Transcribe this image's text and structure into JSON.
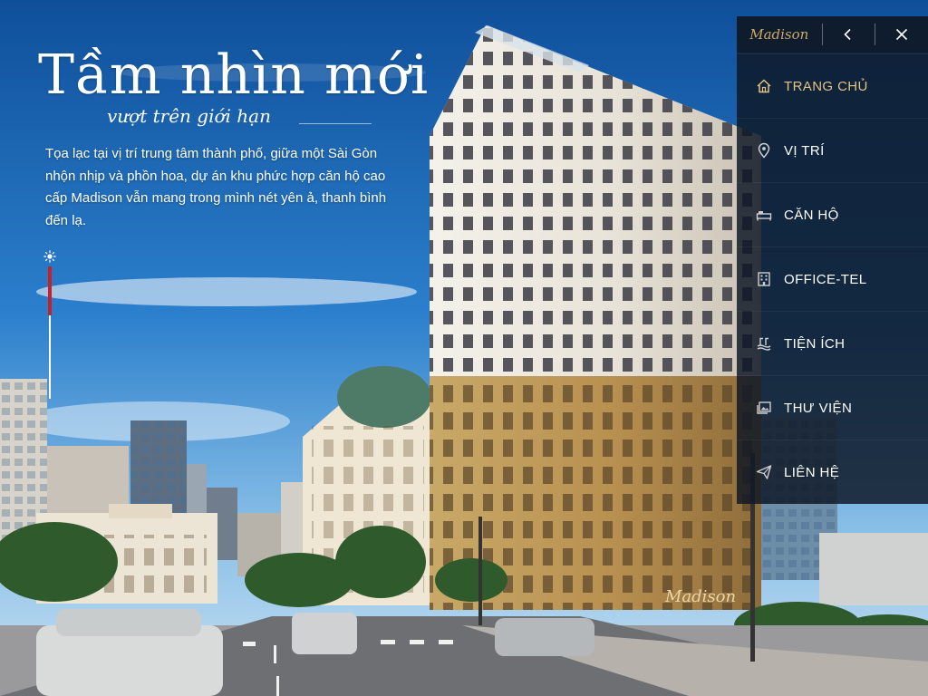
{
  "hero": {
    "title": "Tầm nhìn mới",
    "subtitle": "vượt trên giới hạn",
    "description": "Tọa lạc tại vị trí trung tâm thành phố, giữa một Sài Gòn nhộn nhịp và phồn hoa, dự án khu phức hợp căn hộ cao cấp Madison vẫn mang trong mình nét yên ả, thanh bình đến lạ."
  },
  "slider": {
    "level": 0.37,
    "icon": "sun-icon"
  },
  "menu": {
    "brand": "Madison",
    "back_icon": "chevron-left-icon",
    "close_icon": "close-icon",
    "items": [
      {
        "label": "TRANG CHỦ",
        "icon": "home-icon",
        "active": true
      },
      {
        "label": "VỊ TRÍ",
        "icon": "location-pin-icon",
        "active": false
      },
      {
        "label": "CĂN HỘ",
        "icon": "bed-icon",
        "active": false
      },
      {
        "label": "OFFICE-TEL",
        "icon": "office-building-icon",
        "active": false
      },
      {
        "label": "TIỆN ÍCH",
        "icon": "amenities-icon",
        "active": false
      },
      {
        "label": "THƯ VIỆN",
        "icon": "gallery-icon",
        "active": false
      },
      {
        "label": "LIÊN HỆ",
        "icon": "send-icon",
        "active": false
      }
    ]
  },
  "building_sign": "Madison",
  "colors": {
    "accent_gold": "#caa865",
    "active_label": "#e2c384",
    "menu_bg": "#0e1826",
    "slider_fill": "#c8202a"
  }
}
